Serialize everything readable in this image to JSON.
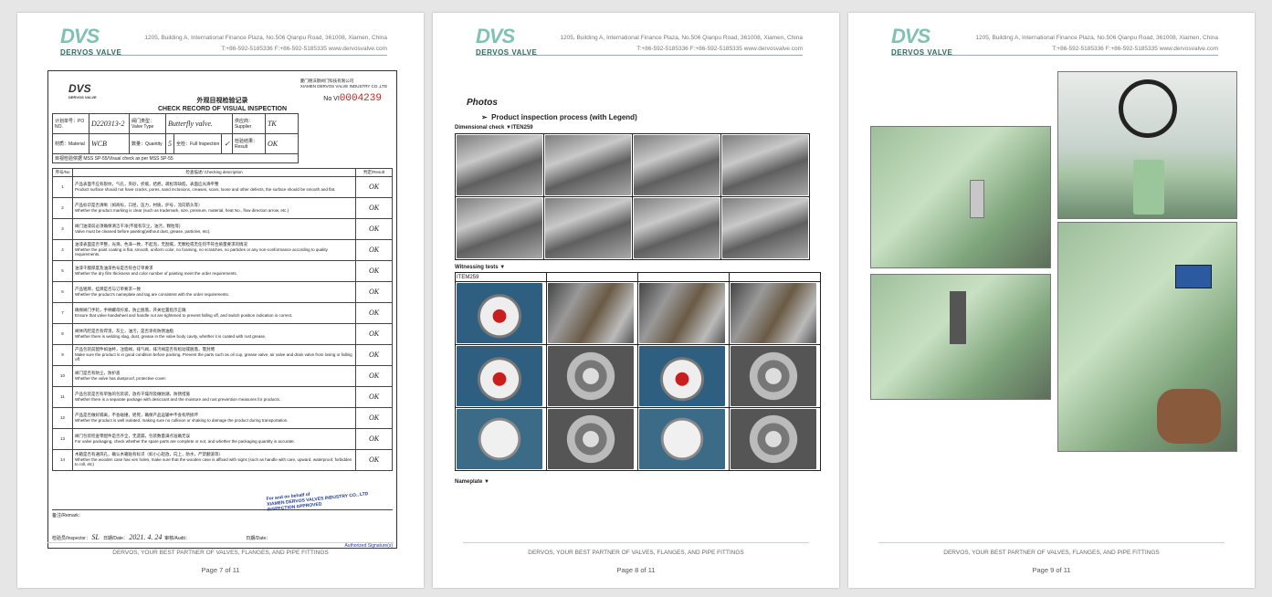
{
  "header": {
    "logo_text": "DVS",
    "logo_sub": "DERVOS VALVE",
    "address": "1205, Building A, International Finance Plaza, No.506 Qianpu Road, 361008, Xiamen, China",
    "contact": "T:+86-592-5185336    F:+86-592-5185335    www.dervosvalve.com"
  },
  "footer": {
    "slogan": "DERVOS, YOUR BEST PARTNER OF VALVES, FLANGES, AND PIPE FITTINGS"
  },
  "pages": [
    {
      "page_no": "Page 7 of 11"
    },
    {
      "page_no": "Page 8 of 11"
    },
    {
      "page_no": "Page 9 of 11"
    }
  ],
  "form": {
    "logo": "DVS",
    "logo_sub": "DERVOS VALVE",
    "company_cn": "厦门德沃斯阀门科技有限公司",
    "company_en": "XIAMEN DERVOS VALVE INDUSTRY CO.,LTD",
    "no_label": "No VI",
    "no_value": "0004239",
    "title_cn": "外观目视检验记录",
    "title_en": "CHECK RECORD OF VISUAL INSPECTION",
    "po_label": "计划单号：PO NO.",
    "po_value": "D220313-2",
    "type_label": "阀门类型：Valve Type",
    "type_value": "Butterfly valve.",
    "supplier_label": "供应商：Supplier",
    "supplier_value": "TK",
    "material_label": "材质：Material",
    "material_value": "WCB",
    "qty_label": "数量：Quantity",
    "qty_value": "5",
    "full_label": "全检：Full Inspection",
    "full_value": "✓",
    "result_label": "检验结果：Result",
    "result_value": "OK",
    "basis": "目视检验依据 MSS SP-55/Visual check as per  MSS SP-55",
    "col_no": "序号/No",
    "col_desc": "检查描述/ Checking description",
    "col_res": "判定/Result",
    "items": [
      {
        "no": "1",
        "cn": "产品表面不应有裂纹，气孔，夹砂，折痕，结疤，疏松等缺陷，表面应光滑平整",
        "en": "Product surface should not have cracks, pores, sand inclusions, creases, scars, loose and other defects, the surface should be smooth and flat.",
        "res": "OK"
      },
      {
        "no": "2",
        "cn": "产品标识是否清晰（如商标，口径，压力，材质，炉号，流向箭头等）",
        "en": "Whether the product marking is clear (such as trademark, size, pressure, material, heat No., flow direction arrow, etc.)",
        "res": "OK"
      },
      {
        "no": "3",
        "cn": "阀门油漆前必须确保清洁干净(不能有灰尘，油污，颗粒等)",
        "en": "Valve must be cleaned before painting(without dust, grease, particles, etc).",
        "res": "OK"
      },
      {
        "no": "4",
        "cn": "油漆表面是否平整，光滑，色泽一致，不起泡，无刮痕，无颗粒或无任何不符合质量要求的情况",
        "en": "Whether the paint coating is flat, smooth, uniform color, no foaming, no scratches, no particles or any non-conformance according to quality requirements.",
        "res": "OK"
      },
      {
        "no": "5",
        "cn": "油漆干膜厚度及油漆色号是否符合订单要求",
        "en": "Whether the dry film thickness and color number of painting meet the order requirements.",
        "res": "OK"
      },
      {
        "no": "6",
        "cn": "产品铭牌，挂牌是否与订单要求一致",
        "en": "Whether the product's nameplate and tag are consistent with the order requirements.",
        "res": "OK"
      },
      {
        "no": "7",
        "cn": "确保阀门手轮，手柄螺母拧紧，防止脱落，开关位置指示正确",
        "en": "Ensure that valve handwheel and handle nut are tightened to prevent falling off, and switch position indication is correct.",
        "res": "OK"
      },
      {
        "no": "8",
        "cn": "阀体内腔是否有焊渣，灰尘，油污，是否涂有防锈油脂",
        "en": "Whether there is welding slag, dust, grease in the valve body cavity, whether it is coated with rust grease.",
        "res": "OK"
      },
      {
        "no": "9",
        "cn": "产品包装前配件如油杯，注脂阀，排气阀，排污阀是否有松动或脱落，需封堵",
        "en": "Make sure the product is in good condition before packing. Prevent the parts such as oil cup, grease valve, air valve and drain valve from losing or falling off.",
        "res": "OK"
      },
      {
        "no": "10",
        "cn": "阀门是否有防尘，防护盖",
        "en": "Whether the valve has dustproof, protective cover.",
        "res": "OK"
      },
      {
        "no": "11",
        "cn": "产品包装是否有单独的包装袋，放有干燥剂及做防潮，防锈措施",
        "en": "Whether there is a separate package with desiccant and the moisture and rust prevention measures for products.",
        "res": "OK"
      },
      {
        "no": "12",
        "cn": "产品是否做好隔离，不会碰撞，摇晃，确保产品运输中不会有所损坏",
        "en": "Whether the product is well isolated, making sure no collision or shaking to damage the product during transportation.",
        "res": "OK"
      },
      {
        "no": "13",
        "cn": "阀门包装检查零配件是否齐全，无遗漏，包装数量满点准确无误",
        "en": "For valve packaging, check whether the spare parts are complete or not, and whether the packaging quantity is accurate.",
        "res": "OK"
      },
      {
        "no": "14",
        "cn": "木箱是否有通风孔，确认木箱贴有标识（如小心轻放，向上，防水，严禁翻滚等）",
        "en": "Whether the wooden case has ven holes, make sure that the wooden case is affixed with signs (such as handle with care, upward, waterproof,  forbidden to roll, etc)",
        "res": "OK"
      }
    ],
    "remark_label": "备注/Remark：",
    "inspector_label": "检验员/Inspector：",
    "inspector_value": "SL",
    "date_label": "日期/Date：",
    "date_value": "2021. 4. 24",
    "audit_label": "审核/Audit：",
    "date2_label": "日期/Date：",
    "stamp_l1": "For and on behalf of",
    "stamp_l2": "XIAMEN DERVOS VALVES INDUSTRY CO., LTD",
    "stamp_l3": "INSPECTION  APPROVED",
    "stamp_l4": "Authorized Signature(s)"
  },
  "photos": {
    "title": "Photos",
    "subtitle": "Product inspection process (with Legend)",
    "dim_label": "Dimensional check  ▼ITEN259",
    "witness_label": "Witnessing tests  ▼",
    "item_label": "ITEM259",
    "nameplate_label": "Nameplate  ▼"
  }
}
